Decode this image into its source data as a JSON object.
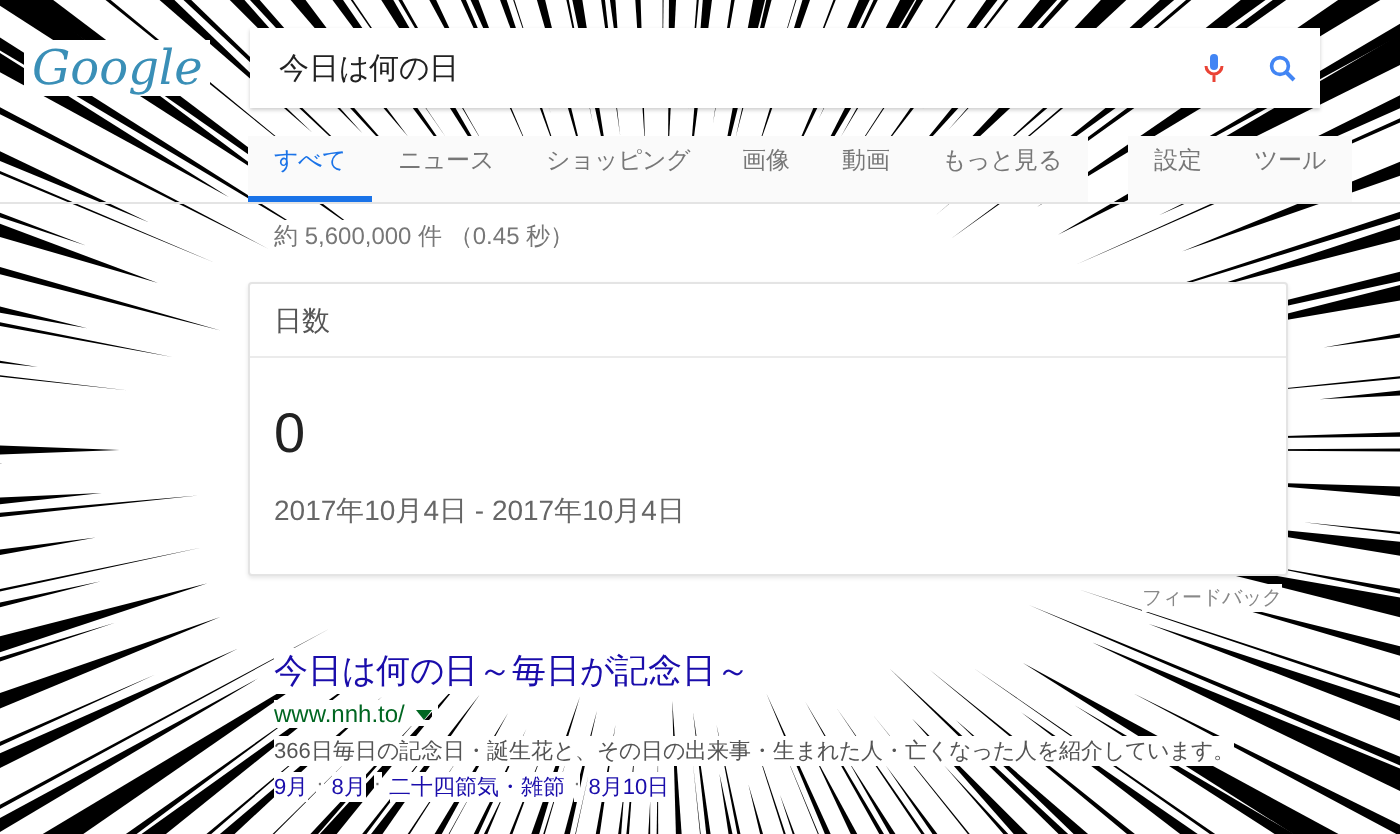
{
  "header": {
    "logo": "Google",
    "query": "今日は何の日"
  },
  "tabs": [
    {
      "label": "すべて",
      "selected": true
    },
    {
      "label": "ニュース",
      "selected": false
    },
    {
      "label": "ショッピング",
      "selected": false
    },
    {
      "label": "画像",
      "selected": false
    },
    {
      "label": "動画",
      "selected": false
    },
    {
      "label": "もっと見る",
      "selected": false
    },
    {
      "label": "設定",
      "selected": false
    },
    {
      "label": "ツール",
      "selected": false
    }
  ],
  "result_stats": "約 5,600,000 件 （0.45 秒）",
  "calculator_card": {
    "title": "日数",
    "value": "0",
    "range": "2017年10月4日 - 2017年10月4日"
  },
  "feedback": "フィードバック",
  "results": [
    {
      "title": "今日は何の日～毎日が記念日～",
      "url": "www.nnh.to/",
      "snippet": "366日毎日の記念日・誕生花と、その日の出来事・生まれた人・亡くなった人を紹介しています。",
      "separator": "·",
      "links": [
        "9月",
        "8月",
        "二十四節気・雑節",
        "8月10日"
      ]
    }
  ]
}
